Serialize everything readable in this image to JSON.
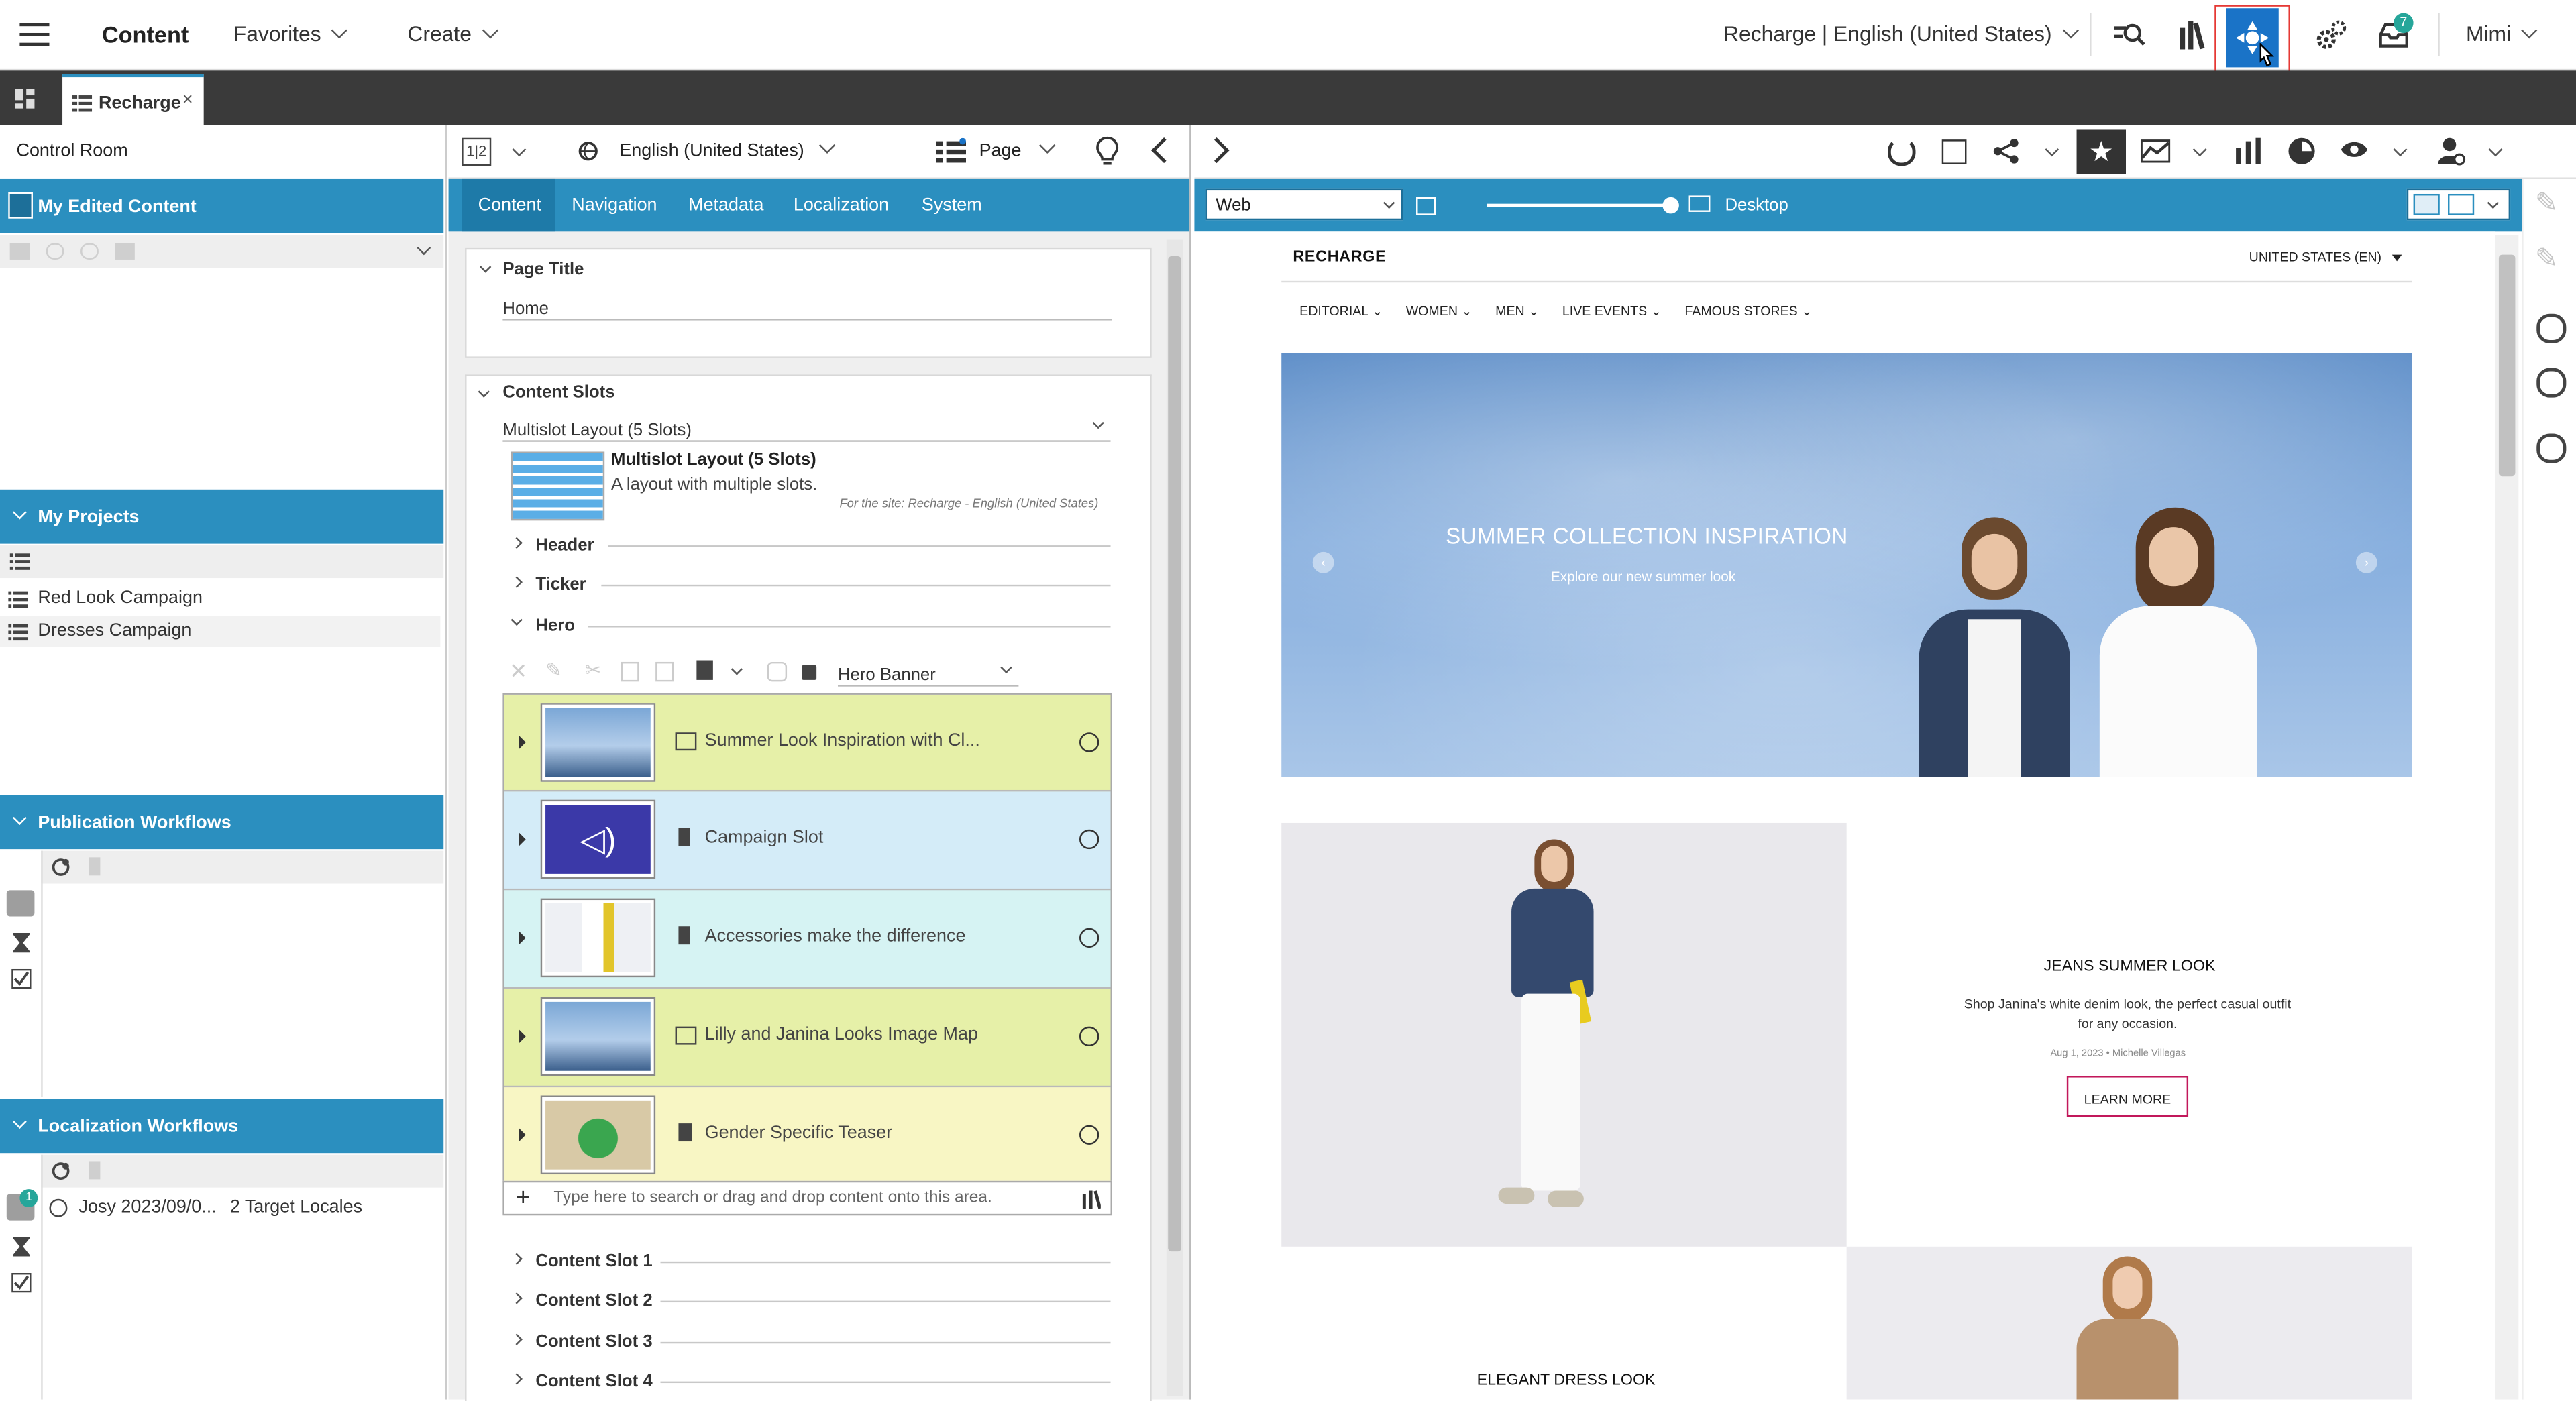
{
  "topbar": {
    "app_title": "Content",
    "favorites_label": "Favorites",
    "create_label": "Create",
    "site_selector": "Recharge | English (United States)",
    "notifications_count": "7",
    "user_name": "Mimi"
  },
  "tabstrip": {
    "tab_label": "Recharge"
  },
  "left_panel": {
    "title": "Control Room",
    "my_edited_content": "My Edited Content",
    "my_projects": "My Projects",
    "projects": [
      "Red Look Campaign",
      "Dresses Campaign"
    ],
    "publication_workflows": "Publication Workflows",
    "localization_workflows": "Localization Workflows",
    "localization_badge": "1",
    "localization_item_name": "Josy 2023/09/0...",
    "localization_item_targets": "2 Target Locales"
  },
  "editor": {
    "locale": "English (United States)",
    "type_label": "Page",
    "tabs": [
      "Content",
      "Navigation",
      "Metadata",
      "Localization",
      "System"
    ],
    "page_title_label": "Page Title",
    "page_title_value": "Home",
    "content_slots_label": "Content Slots",
    "layout_select": "Multislot Layout (5 Slots)",
    "layout_name": "Multislot Layout (5 Slots)",
    "layout_desc": "A layout with multiple slots.",
    "layout_site_note": "For the site: Recharge - English (United States)",
    "slots": [
      "Header",
      "Ticker",
      "Hero"
    ],
    "hero_type_select": "Hero Banner",
    "hero_items": [
      {
        "label": "Summer Look Inspiration with Cl...",
        "bg": "#e6f0a8"
      },
      {
        "label": "Campaign Slot",
        "bg": "#d4ecf8"
      },
      {
        "label": "Accessories make the difference",
        "bg": "#d6f3f3"
      },
      {
        "label": "Lilly and Janina Looks Image Map",
        "bg": "#e6f0a8"
      },
      {
        "label": "Gender Specific Teaser",
        "bg": "#f8f6c4"
      }
    ],
    "drop_placeholder": "Type here to search or drag and drop content onto this area.",
    "more_slots": [
      "Content Slot 1",
      "Content Slot 2",
      "Content Slot 3",
      "Content Slot 4"
    ]
  },
  "preview": {
    "channel_select": "Web",
    "device_label": "Desktop",
    "site": {
      "logo": "RECHARGE",
      "locale": "UNITED STATES (EN)",
      "nav": [
        "EDITORIAL",
        "WOMEN",
        "MEN",
        "LIVE EVENTS",
        "FAMOUS STORES"
      ],
      "hero_title": "SUMMER COLLECTION INSPIRATION",
      "hero_subtitle": "Explore our new summer look",
      "teaser_title": "JEANS SUMMER LOOK",
      "teaser_text": "Shop Janina's white denim look, the perfect casual outfit for any occasion.",
      "teaser_meta": "Aug 1, 2023 • Michelle Villegas",
      "teaser_button": "LEARN MORE",
      "second_title": "ELEGANT DRESS LOOK"
    }
  },
  "colors": {
    "accent": "#2b8fbf",
    "highlight_button": "#1a73c7",
    "highlight_outline": "#e53935"
  }
}
